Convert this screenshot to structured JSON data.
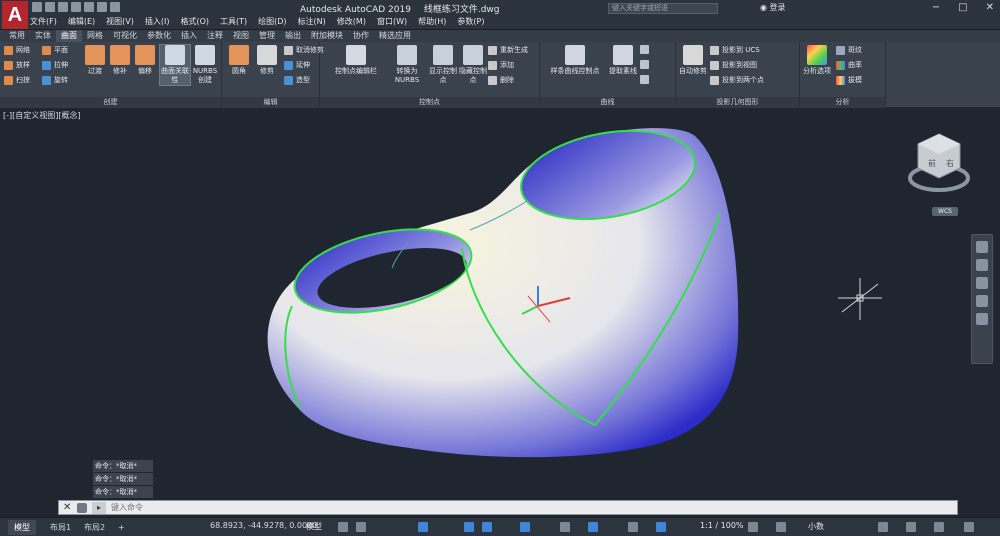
{
  "app": {
    "logo": "A",
    "title": "Autodesk AutoCAD 2019",
    "file_name": "线框练习文件.dwg",
    "search_placeholder": "键入关键字或短语",
    "login": "登录"
  },
  "menus": [
    "文件(F)",
    "编辑(E)",
    "视图(V)",
    "插入(I)",
    "格式(O)",
    "工具(T)",
    "绘图(D)",
    "标注(N)",
    "修改(M)",
    "窗口(W)",
    "帮助(H)",
    "参数(P)"
  ],
  "ribbon_tabs": [
    "常用",
    "实体",
    "曲面",
    "网格",
    "可视化",
    "参数化",
    "插入",
    "注释",
    "视图",
    "管理",
    "输出",
    "附加模块",
    "协作",
    "精选应用"
  ],
  "active_ribbon_tab": "曲面",
  "ribbon": {
    "create": {
      "title": "创建",
      "small": [
        "网络",
        "放样",
        "扫掠",
        "平面",
        "拉伸",
        "旋转"
      ],
      "big": [
        "过渡",
        "修补",
        "偏移",
        "曲面关联性",
        "NURBS创建"
      ]
    },
    "edit": {
      "title": "编辑",
      "big": [
        "圆角",
        "修剪"
      ],
      "small": [
        "取消修剪",
        "延伸",
        "造型"
      ]
    },
    "control_points": {
      "title": "控制点",
      "big": [
        "控制点编辑栏",
        "转换为NURBS",
        "显示控制点",
        "隐藏控制点"
      ],
      "small": [
        "重新生成",
        "添加",
        "删除"
      ]
    },
    "curves": {
      "title": "曲线",
      "big": [
        "样条曲线控制点",
        "提取素线"
      ]
    },
    "projection": {
      "title": "投影几何图形",
      "big": [
        "自动修剪"
      ],
      "small": [
        "投影到 UCS",
        "投影到视图",
        "投影到两个点"
      ]
    },
    "analysis": {
      "title": "分析",
      "big": [
        "分析选项"
      ],
      "small": [
        "斑纹",
        "曲率",
        "拔模"
      ]
    }
  },
  "viewport": {
    "label": "[-][自定义视图][概念]",
    "viewcube_faces": [
      "前",
      "右"
    ],
    "wcs": "WCS"
  },
  "command_history": [
    "命令：*取消*",
    "命令：*取消*",
    "命令：*取消*"
  ],
  "command_line": {
    "placeholder": "键入命令",
    "close_glyph": "✕"
  },
  "status": {
    "tabs": [
      "模型",
      "布局1",
      "布局2"
    ],
    "add_tab": "+",
    "coords": "68.8923, -44.9278, 0.0000",
    "model": "模型",
    "scale": "1:1 / 100%",
    "units": "小数"
  },
  "colors": {
    "accent_red": "#b3262e",
    "surface_blue": "#2c2cc9",
    "edge_green": "#33e04a",
    "viewport_bg": "#1f2630"
  }
}
